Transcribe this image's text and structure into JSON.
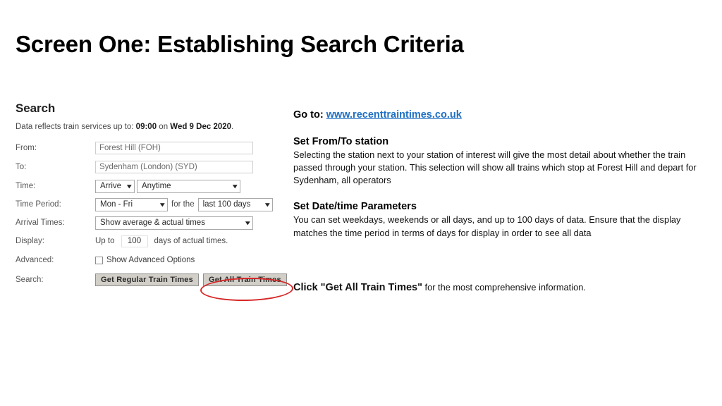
{
  "slide": {
    "title": "Screen One: Establishing Search Criteria"
  },
  "search_panel": {
    "heading": "Search",
    "data_note": {
      "prefix": "Data reflects train services up to:",
      "time": "09:00",
      "middle": "on",
      "date": "Wed 9 Dec 2020",
      "suffix": "."
    },
    "rows": {
      "from": {
        "label": "From:",
        "value": "Forest Hill (FOH)"
      },
      "to": {
        "label": "To:",
        "value": "Sydenham (London) (SYD)"
      },
      "time": {
        "label": "Time:",
        "direction": "Arrive",
        "when": "Anytime"
      },
      "time_period": {
        "label": "Time Period:",
        "days": "Mon - Fri",
        "connector": "for the",
        "range": "last 100 days"
      },
      "arrival_times": {
        "label": "Arrival Times:",
        "value": "Show average & actual times"
      },
      "display": {
        "label": "Display:",
        "prefix": "Up to",
        "value": "100",
        "suffix": "days of actual times."
      },
      "advanced": {
        "label": "Advanced:",
        "checkbox_label": "Show Advanced Options"
      },
      "search": {
        "label": "Search:",
        "regular_button": "Get Regular Train Times",
        "all_button": "Get All Train Times"
      }
    }
  },
  "instructions": {
    "goto": {
      "prefix": "Go to:",
      "url": "www.recenttraintimes.co.uk"
    },
    "station": {
      "heading": "Set From/To station",
      "body": "Selecting the station next to your station of interest will give the most detail about whether the train passed through your station. This selection will show all trains which stop at Forest Hill and depart for Sydenham, all operators"
    },
    "datetime": {
      "heading": "Set Date/time Parameters",
      "body": "You can set weekdays, weekends or all days, and up to 100 days of data. Ensure that the display matches the time period in terms of days for display in order to see all data"
    },
    "click": {
      "bold": "Click \"Get All Train Times\"",
      "rest": "for the most comprehensive information."
    }
  },
  "colors": {
    "annotation": "#d62828",
    "link": "#1f6fc4",
    "button_face": "#d2cfc8"
  }
}
